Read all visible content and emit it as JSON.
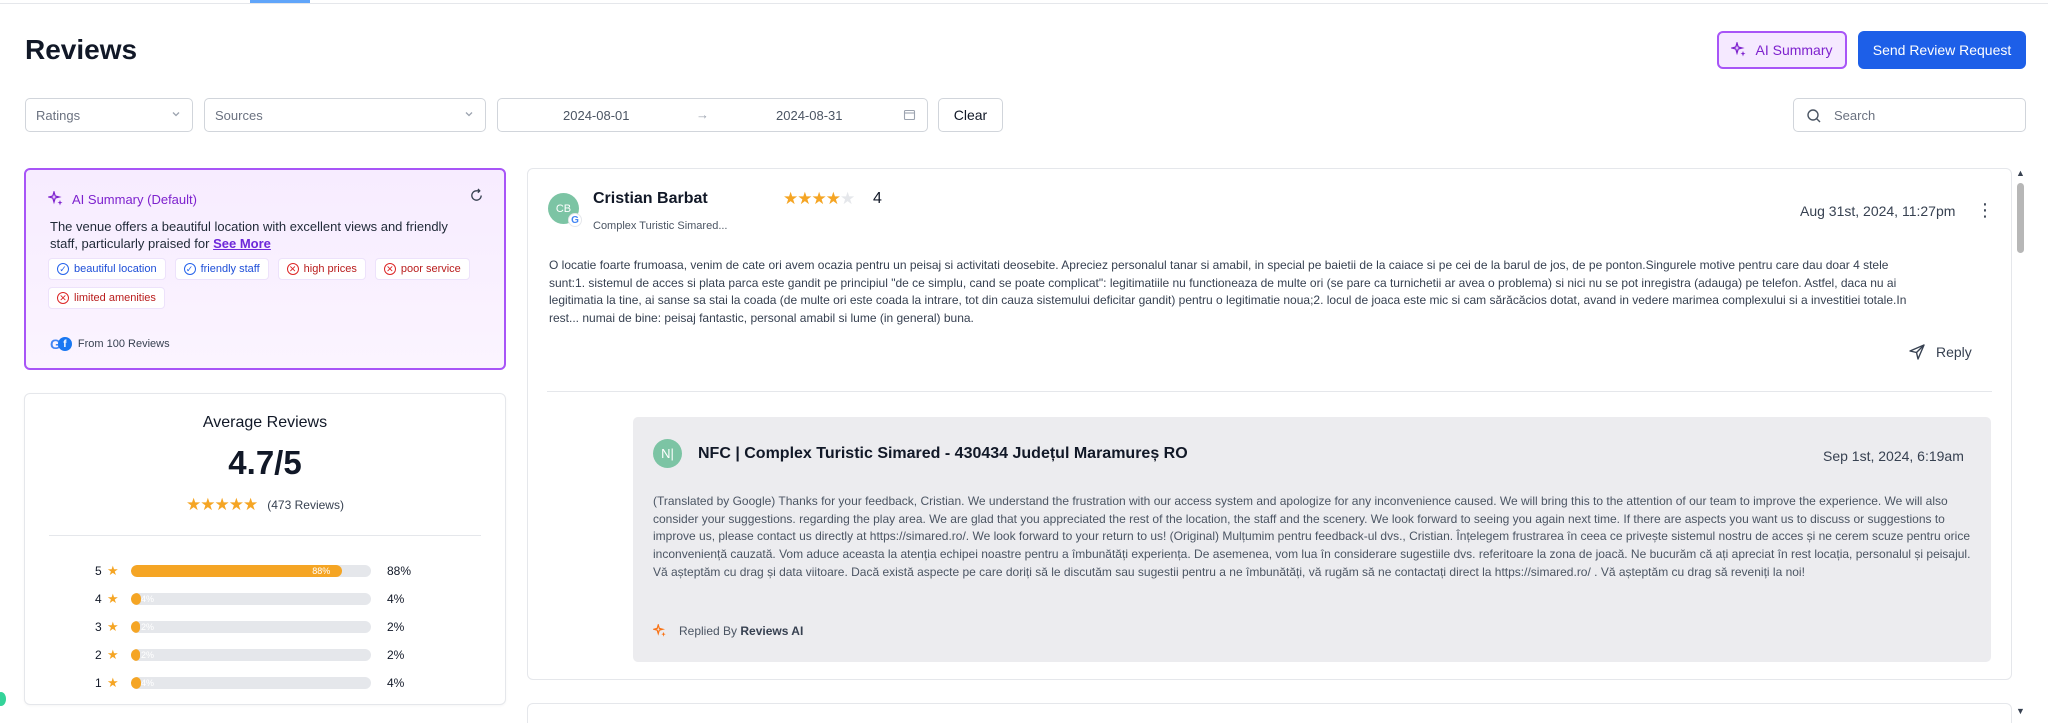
{
  "page": {
    "title": "Reviews"
  },
  "header": {
    "ai_summary_label": "AI Summary",
    "send_request_label": "Send Review Request"
  },
  "filters": {
    "ratings_placeholder": "Ratings",
    "sources_placeholder": "Sources",
    "date_start": "2024-08-01",
    "date_end": "2024-08-31",
    "date_separator": "→",
    "clear_label": "Clear",
    "search_placeholder": "Search"
  },
  "ai_summary": {
    "title": "AI Summary (Default)",
    "text": "The venue offers a beautiful location with excellent views and friendly staff, particularly praised for",
    "see_more": "See More",
    "tags": [
      {
        "label": "beautiful location",
        "sentiment": "positive"
      },
      {
        "label": "friendly staff",
        "sentiment": "positive"
      },
      {
        "label": "high prices",
        "sentiment": "negative"
      },
      {
        "label": "poor service",
        "sentiment": "negative"
      },
      {
        "label": "limited amenities",
        "sentiment": "negative"
      }
    ],
    "from_text": "From 100 Reviews"
  },
  "average": {
    "title": "Average Reviews",
    "score": "4.7/5",
    "count_text": "(473 Reviews)",
    "distribution": [
      {
        "stars": "5",
        "percent": 88,
        "label": "88%"
      },
      {
        "stars": "4",
        "percent": 4,
        "label": "4%"
      },
      {
        "stars": "3",
        "percent": 2,
        "label": "2%"
      },
      {
        "stars": "2",
        "percent": 2,
        "label": "2%"
      },
      {
        "stars": "1",
        "percent": 4,
        "label": "4%"
      }
    ]
  },
  "review": {
    "avatar_initials": "CB",
    "author": "Cristian Barbat",
    "location": "Complex Turistic Simared...",
    "rating": "4",
    "date": "Aug 31st, 2024, 11:27pm",
    "text": "O locatie foarte frumoasa, venim de cate ori avem ocazia pentru un peisaj si activitati deosebite. Apreciez personalul tanar si amabil, in special pe baietii de la caiace si pe cei de la barul de jos, de pe ponton.Singurele motive pentru care dau doar 4 stele sunt:1. sistemul de acces si plata parca este gandit pe principiul \"de ce simplu, cand se poate complicat\": legitimatiile nu functioneaza de multe ori (se pare ca turnichetii ar avea o problema) si nici nu se pot inregistra (adauga) pe telefon. Astfel, daca nu ai legitimatia la tine, ai sanse sa stai la coada (de multe ori este coada la intrare, tot din cauza sistemului deficitar gandit) pentru o legitimatie noua;2. locul de joaca este mic si cam sărăcăcios dotat, avand in vedere marimea complexului si a investitiei totale.In rest... numai de bine: peisaj fantastic, personal amabil si lume (in general) buna.",
    "reply_label": "Reply",
    "response": {
      "avatar_initials": "N|",
      "title": "NFC | Complex Turistic Simared - 430434 Județul Maramureș RO",
      "date": "Sep 1st, 2024, 6:19am",
      "text": "(Translated by Google) Thanks for your feedback, Cristian. We understand the frustration with our access system and apologize for any inconvenience caused. We will bring this to the attention of our team to improve the experience. We will also consider your suggestions. regarding the play area. We are glad that you appreciated the rest of the location, the staff and the scenery. We look forward to seeing you again next time. If there are aspects you want us to discuss or suggestions to improve us, please contact us directly at https://simared.ro/. We look forward to your return to us! (Original) Mulțumim pentru feedback-ul dvs., Cristian. Înțelegem frustrarea în ceea ce privește sistemul nostru de acces și ne cerem scuze pentru orice inconveniență cauzată. Vom aduce aceasta la atenția echipei noastre pentru a îmbunătăți experiența. De asemenea, vom lua în considerare sugestiile dvs. referitoare la zona de joacă. Ne bucurăm că ați apreciat în rest locația, personalul și peisajul. Vă așteptăm cu drag și data viitoare. Dacă există aspecte pe care doriți să le discutăm sau sugestii pentru a ne îmbunătăți, vă rugăm să ne contactați direct la https://simared.ro/ . Vă așteptăm cu drag să reveniți la noi!",
      "replied_by_prefix": "Replied By",
      "replied_by": "Reviews AI"
    }
  },
  "colors": {
    "accent_purple": "#a855f7",
    "primary_blue": "#1d5fe8",
    "star": "#f5a524",
    "positive": "#2563eb",
    "negative": "#dc2626"
  }
}
